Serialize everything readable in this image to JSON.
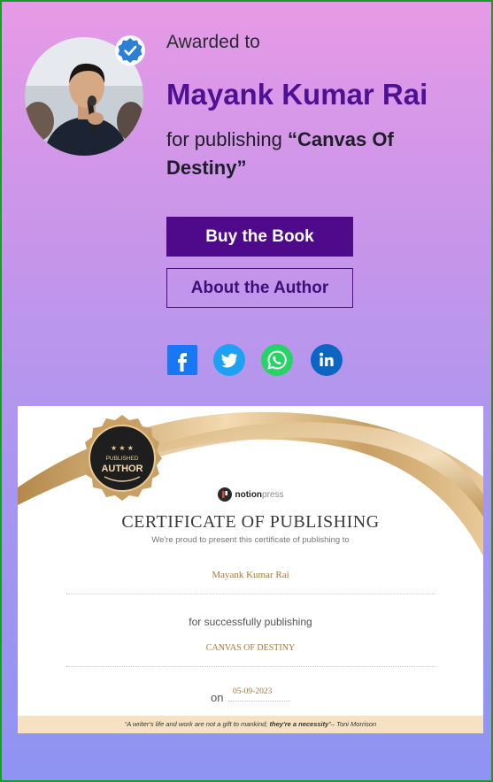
{
  "award": {
    "awarded_label": "Awarded to",
    "author_name": "Mayank Kumar Rai",
    "for_publishing_prefix": "for publishing",
    "book_title_quoted": "“Canvas Of Destiny”"
  },
  "actions": {
    "buy_label": "Buy the Book",
    "about_label": "About the Author"
  },
  "social": [
    "facebook-icon",
    "twitter-icon",
    "whatsapp-icon",
    "linkedin-icon"
  ],
  "certificate": {
    "badge_top": "PUBLISHED",
    "badge_main": "AUTHOR",
    "logo_bold": "notion",
    "logo_light": "press",
    "title": "CERTIFICATE OF PUBLISHING",
    "subtitle": "We're proud to present this certificate of publishing to",
    "recipient": "Mayank Kumar Rai",
    "for_text": "for successfully publishing",
    "book": "CANVAS OF DESTINY",
    "on_label": "on",
    "date": "05-09-2023",
    "quote_plain": "“A writer's life and work are not a gift to mankind; ",
    "quote_bold": "they're a necessity",
    "quote_end": "”– Toni Morrison"
  },
  "colors": {
    "accent": "#4e0a8a",
    "name": "#4e1192",
    "facebook": "#1877f2",
    "twitter": "#1da1f2",
    "whatsapp": "#25d366",
    "linkedin": "#0a66c2",
    "gold": "#c9a063"
  }
}
